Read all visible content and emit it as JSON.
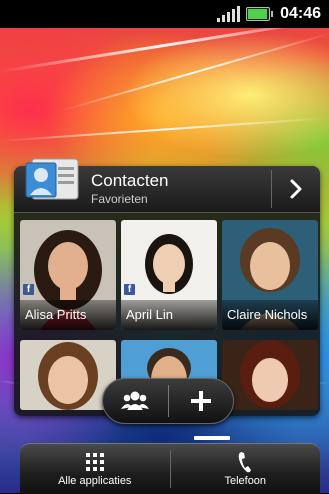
{
  "status_bar": {
    "time": "04:46",
    "icons": [
      "signal-icon",
      "battery-icon"
    ],
    "battery_color": "#4fd14a"
  },
  "widget": {
    "title": "Contacten",
    "subtitle": "Favorieten",
    "icons": [
      "contact-card-icon",
      "chevron-right-icon"
    ],
    "contacts": [
      {
        "name": "Alisa Pritts",
        "facebook": true
      },
      {
        "name": "April Lin",
        "facebook": true
      },
      {
        "name": "Claire Nichols",
        "facebook": false
      },
      {
        "name": "",
        "facebook": false
      },
      {
        "name": "",
        "facebook": false
      },
      {
        "name": "",
        "facebook": false
      }
    ]
  },
  "action_pill": {
    "icons": [
      "people-icon",
      "plus-icon"
    ]
  },
  "launcher": {
    "all_apps_label": "Alle applicaties",
    "phone_label": "Telefoon",
    "icons": [
      "grid-icon",
      "phone-icon"
    ]
  }
}
